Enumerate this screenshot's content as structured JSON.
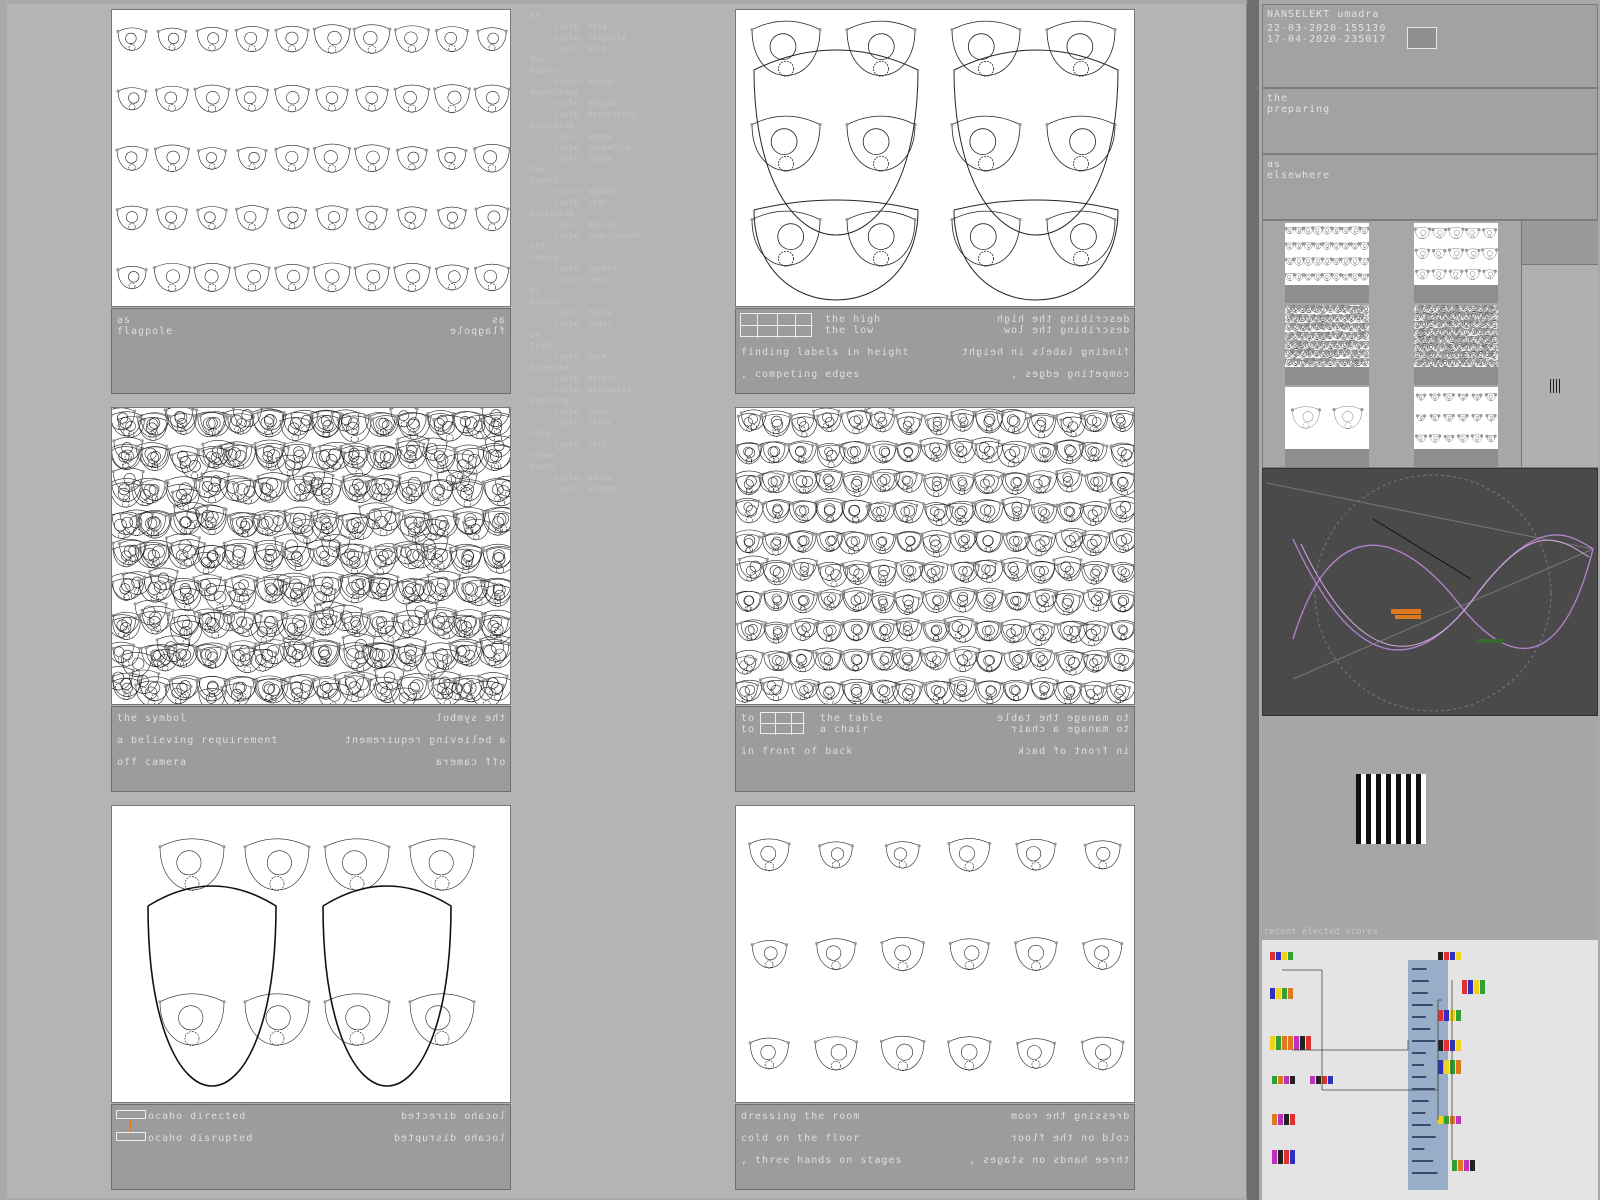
{
  "panels": [
    {
      "caption_rows": [
        {
          "left": "as",
          "right": "as"
        },
        {
          "left": "flagpole",
          "right": "flagpole"
        }
      ]
    },
    {
      "caption_rows": [
        {
          "left": "the high",
          "right": "describing the high",
          "indent": true
        },
        {
          "left": "the low",
          "right": "describing the low",
          "indent": true
        },
        {
          "left": "finding labels in height",
          "right": "finding labels in height"
        },
        {
          "left": ", competing edges",
          "right": "competing edges ,"
        }
      ]
    },
    {
      "caption_rows": [
        {
          "left": "the symbol",
          "right": "the symbol"
        },
        {
          "left": "a believing requirement",
          "right": "a believing requirement"
        },
        {
          "left": "off camera",
          "right": "off camera"
        }
      ]
    },
    {
      "caption_rows": [
        {
          "left": "to",
          "right": "to manage the table"
        },
        {
          "left": "to",
          "right": "to manage a chair"
        },
        {
          "left": "the table",
          "right": ""
        },
        {
          "left": "a chair",
          "right": ""
        },
        {
          "left": "in front of back",
          "right": "in front of back"
        }
      ]
    },
    {
      "caption_rows": [
        {
          "left": "ocaho directed",
          "right": "locaho directed"
        },
        {
          "left": "ocaho disrupted",
          "right": "locaho disrupted"
        }
      ]
    },
    {
      "caption_rows": [
        {
          "left": "dressing the room",
          "right": "dressing the room"
        },
        {
          "left": "cold on the floor",
          "right": "cold on the floor"
        },
        {
          "left": ", three hands on stages",
          "right": "three hands on stages ,"
        }
      ]
    }
  ],
  "mid_column": [
    "as",
    "  cycle: flag",
    "  cycle: flagpole",
    "  cycle: pole",
    "the",
    "higher",
    "  cycle: higher",
    "describing",
    "  cycle: height",
    "  cycle: describing",
    "competing",
    "  cycle: edges",
    "  cycle: competing",
    "  cycle: lines",
    "the",
    "symbol",
    "  cycle: symbol",
    "  cycle: sign",
    "believing",
    "  cycle: belief",
    "  cycle: requirement",
    "off",
    "camera",
    "  cycle: camera",
    "  cycle: lens",
    "to",
    "manage",
    "  cycle: table",
    "  cycle: chair",
    "in",
    "front",
    "  cycle: back",
    "directed",
    "  cycle: direct",
    "  cycle: disrupted",
    "dressing",
    "  cycle: room",
    "  cycle: floor",
    "cold",
    "  cycle: cold",
    "three",
    "hands",
    "  cycle: hands",
    "  cycle: stages"
  ],
  "sidebar": {
    "title": "NANSELEKT umadra",
    "dates": [
      "22-03-2020-155130",
      "17-04-2020-235017"
    ],
    "box2": [
      "the",
      "preparing"
    ],
    "box3": [
      "as",
      "elsewhere"
    ],
    "graph_title": "recent elected scores"
  },
  "colors": {
    "accent": "#e07820",
    "curve": "#b080c8",
    "graph_panel": "#98aec8"
  }
}
